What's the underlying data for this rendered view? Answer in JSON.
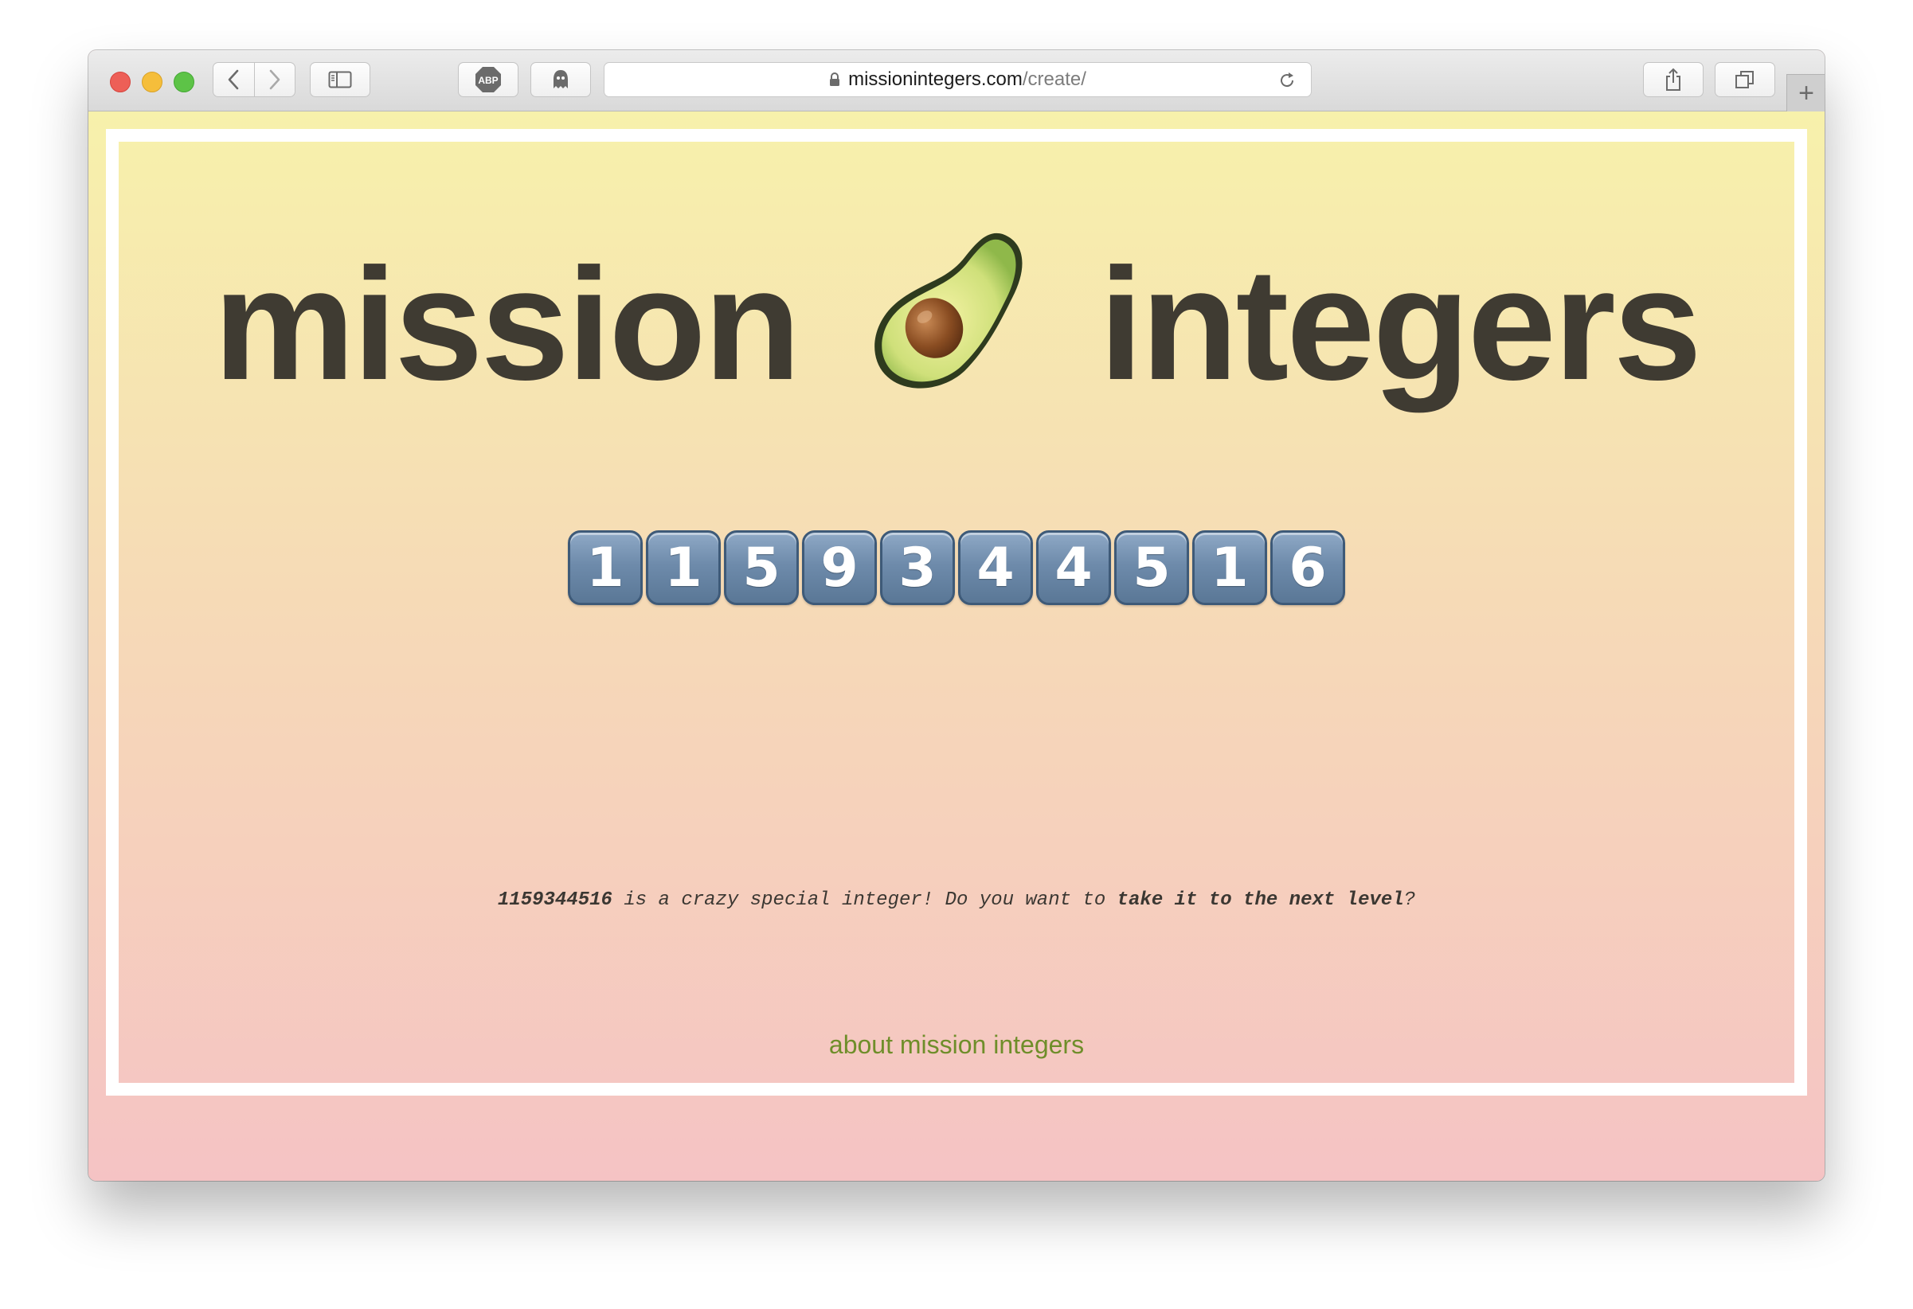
{
  "browser": {
    "url_domain": "missionintegers.com",
    "url_path": "/create/",
    "buttons": {
      "back": "chevron-left-icon",
      "forward": "chevron-right-icon",
      "sidebar": "sidebar-icon",
      "adblock": "ABP",
      "ghostery": "ghost-icon",
      "share": "share-icon",
      "tabs": "tabs-icon",
      "new_tab": "+"
    }
  },
  "page": {
    "title_left": "mission",
    "title_right": "integers",
    "title_emoji": "avocado",
    "digits": [
      "1",
      "1",
      "5",
      "9",
      "3",
      "4",
      "4",
      "5",
      "1",
      "6"
    ],
    "message": {
      "number": "1159344516",
      "middle": " is a crazy special integer! Do you want to ",
      "cta": "take it to the next level",
      "end": "?"
    },
    "about_link": "about mission integers"
  },
  "colors": {
    "gradient_top": "#f7f1ab",
    "gradient_bottom": "#f5c3c4",
    "title_text": "#3f3b32",
    "link": "#6f8e2a",
    "digit_key": "#6e8bab"
  }
}
